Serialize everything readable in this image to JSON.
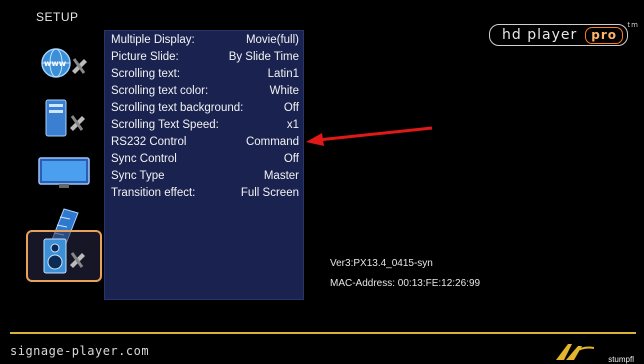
{
  "screen": {
    "title": "SETUP"
  },
  "brand": {
    "name": "hd player",
    "badge": "pro",
    "tm": "tm"
  },
  "menu": {
    "items": [
      {
        "label": "Multiple Display:",
        "value": "Movie(full)"
      },
      {
        "label": "Picture Slide:",
        "value": "By Slide Time"
      },
      {
        "label": "Scrolling text:",
        "value": "Latin1"
      },
      {
        "label": "Scrolling text color:",
        "value": "White"
      },
      {
        "label": "Scrolling text background:",
        "value": "Off"
      },
      {
        "label": "Scrolling Text Speed:",
        "value": "x1"
      },
      {
        "label": "RS232 Control",
        "value": "Command"
      },
      {
        "label": "Sync Control",
        "value": "Off"
      },
      {
        "label": "Sync Type",
        "value": "Master"
      },
      {
        "label": "Transition effect:",
        "value": "Full Screen"
      }
    ]
  },
  "info": {
    "version": "Ver3:PX13.4_0415-syn",
    "mac": "MAC-Address: 00:13:FE:12:26:99"
  },
  "footer": {
    "url": "signage-player.com",
    "company": "stumpfl"
  },
  "colors": {
    "menu_bg": "#1a2350",
    "accent_orange": "#e8a35a",
    "footer_line": "#d8b23a",
    "arrow": "#e01818"
  }
}
